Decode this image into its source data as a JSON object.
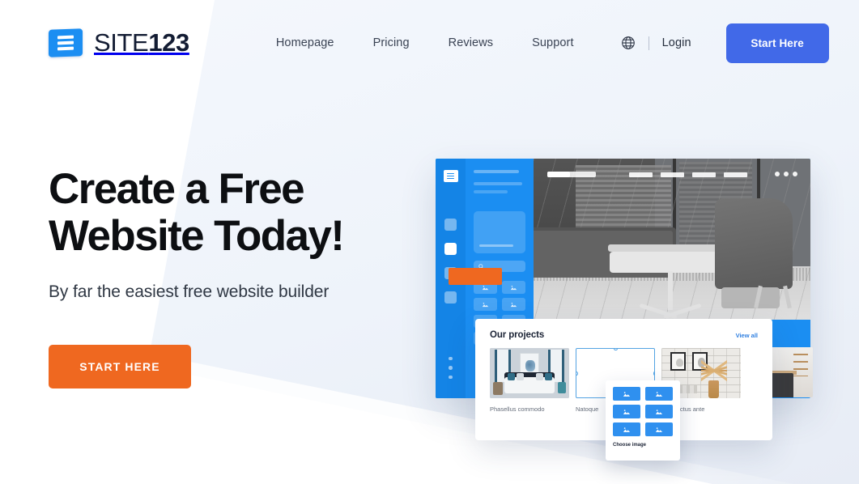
{
  "header": {
    "logo": {
      "text_light": "SITE",
      "text_bold": "123",
      "icon": "hamburger-logo-icon"
    },
    "nav": [
      {
        "label": "Homepage"
      },
      {
        "label": "Pricing"
      },
      {
        "label": "Reviews"
      },
      {
        "label": "Support"
      }
    ],
    "language_icon": "globe-icon",
    "login_label": "Login",
    "start_button_label": "Start Here",
    "start_button_color": "#4169e8"
  },
  "hero": {
    "headline": "Create a Free\nWebsite Today!",
    "subheadline": "By far the easiest free website builder",
    "cta_label": "START HERE",
    "cta_color": "#ef6820"
  },
  "mockup": {
    "sidebar": {
      "logo_icon": "editor-logo-icon",
      "items": [
        {
          "name": "panel-icon-1",
          "active": false
        },
        {
          "name": "panel-icon-2",
          "active": true
        },
        {
          "name": "panel-icon-3",
          "active": false
        },
        {
          "name": "panel-icon-4",
          "active": false
        }
      ],
      "more_dots": "vertical-dots-icon"
    },
    "panel": {
      "search_icon": "search-icon",
      "image_tile_icon": "image-placeholder-icon"
    },
    "preview": {
      "menu_icon": "three-dots-icon",
      "nav_bar_count": 4,
      "accent_block_color": "#ef6820"
    }
  },
  "projects_card": {
    "title": "Our projects",
    "view_all_label": "View all",
    "view_all_color": "#2f7fe0",
    "items": [
      {
        "caption": "Phasellus commodo",
        "selected": false
      },
      {
        "caption": "Natoque",
        "selected": true
      },
      {
        "caption": "culis luctus ante",
        "selected": false
      }
    ]
  },
  "choose_image_popover": {
    "label": "Choose image",
    "tile_icon": "image-placeholder-icon",
    "tile_color": "#2f90ef",
    "tile_count": 6
  }
}
